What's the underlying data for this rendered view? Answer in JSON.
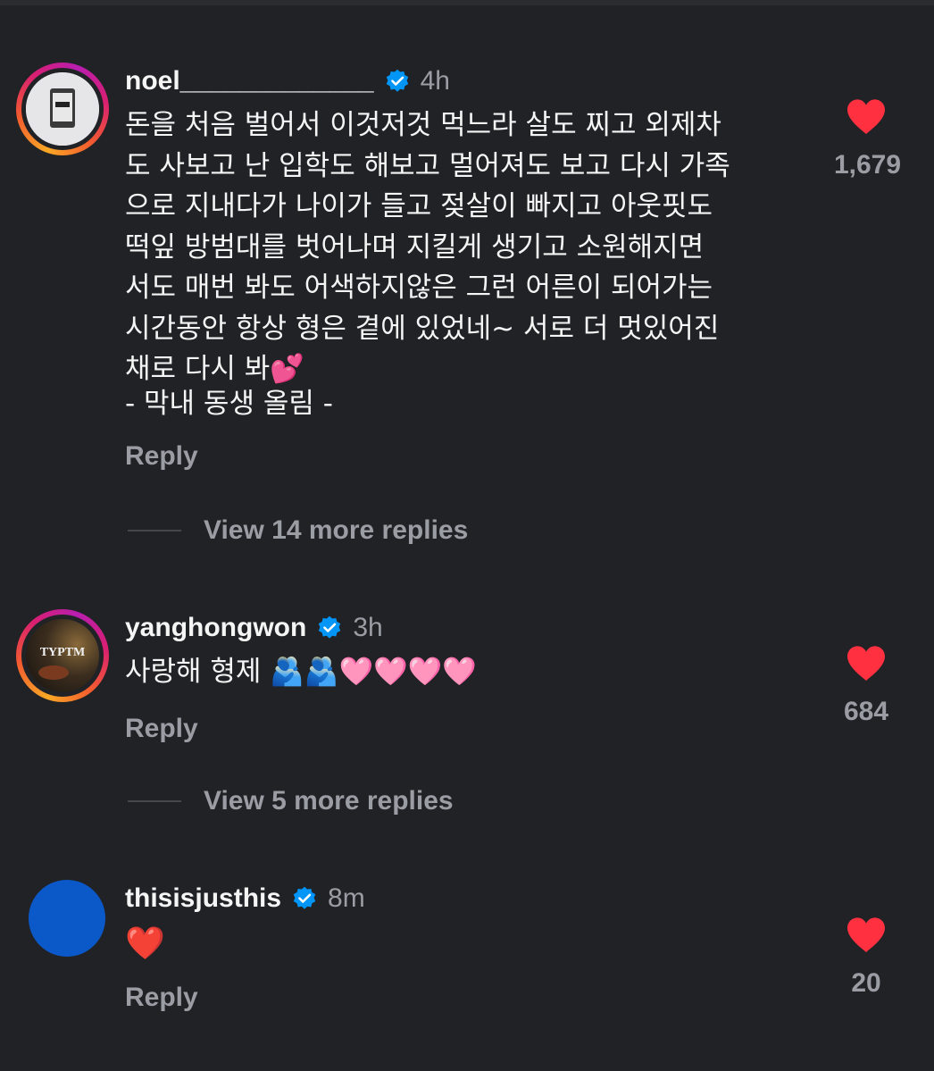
{
  "comments": [
    {
      "username": "noel_____________",
      "time": "4h",
      "body": "돈을 처음 벌어서 이것저것 먹느라 살도 찌고 외제차\n도 사보고 난 입학도 해보고 멀어져도 보고 다시 가족\n으로 지내다가 나이가 들고 젖살이 빠지고 아웃핏도\n떡잎 방범대를 벗어나며 지킬게 생기고 소원해지면\n서도 매번 봐도 어색하지않은 그런 어른이 되어가는\n시간동안 항상 형은 곁에 있었네~ 서로 더 멋있어진\n채로 다시 봐💕",
      "signature": "- 막내 동생 올림 -",
      "reply": "Reply",
      "likes": "1,679",
      "more_replies": "View 14 more replies",
      "avatar_icon": "device-logo-icon"
    },
    {
      "username": "yanghongwon",
      "time": "3h",
      "body": "사랑해 형제 🫂🫂🩷🩷🩷🩷",
      "reply": "Reply",
      "likes": "684",
      "more_replies": "View 5 more replies",
      "avatar_text": "TYPTM"
    },
    {
      "username": "thisisjusthis",
      "time": "8m",
      "body": "❤️",
      "reply": "Reply",
      "likes": "20"
    }
  ],
  "colors": {
    "background": "#212226",
    "like_red": "#ff3040",
    "verified_blue": "#0095f6",
    "muted_text": "#9a9da3"
  }
}
